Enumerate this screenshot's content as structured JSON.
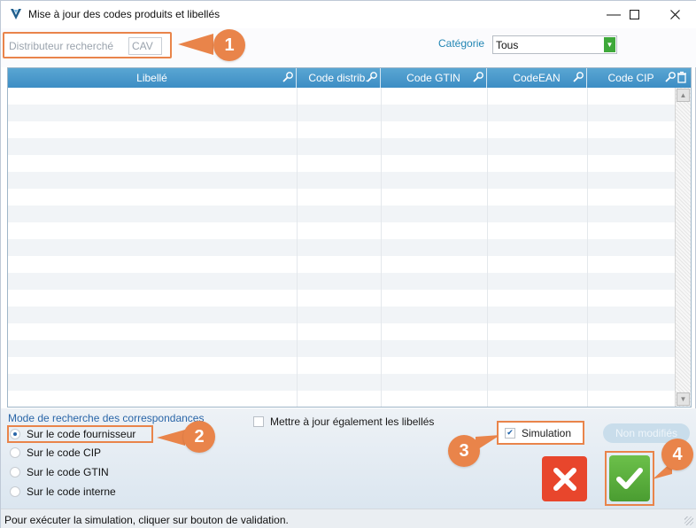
{
  "window": {
    "title": "Mise à jour des codes produits et libellés",
    "minimize": "—",
    "maximize": "☐",
    "close": "✕"
  },
  "search": {
    "label": "Distributeur recherché",
    "value": "CAV"
  },
  "category": {
    "label": "Catégorie",
    "value": "Tous"
  },
  "grid": {
    "columns": [
      "Libellé",
      "Code distrib.",
      "Code GTIN",
      "CodeEAN",
      "Code CIP"
    ],
    "rows": []
  },
  "mode": {
    "title": "Mode de recherche des correspondances",
    "options": [
      {
        "label": "Sur le code fournisseur",
        "selected": true
      },
      {
        "label": "Sur le code CIP",
        "selected": false
      },
      {
        "label": "Sur le code GTIN",
        "selected": false
      },
      {
        "label": "Sur le code interne",
        "selected": false
      }
    ]
  },
  "update_labels": {
    "label": "Mettre à jour également les libellés",
    "checked": false
  },
  "simulation": {
    "label": "Simulation",
    "checked": true
  },
  "non_modifies": {
    "label": "Non modifiés"
  },
  "callouts": [
    "1",
    "2",
    "3",
    "4"
  ],
  "status": {
    "text": "Pour exécuter la simulation, cliquer sur bouton de validation."
  },
  "colors": {
    "accent_orange": "#e9844a",
    "header_blue": "#3c8dc4",
    "ok_green": "#4a9d31",
    "cancel_red": "#e8462c"
  }
}
